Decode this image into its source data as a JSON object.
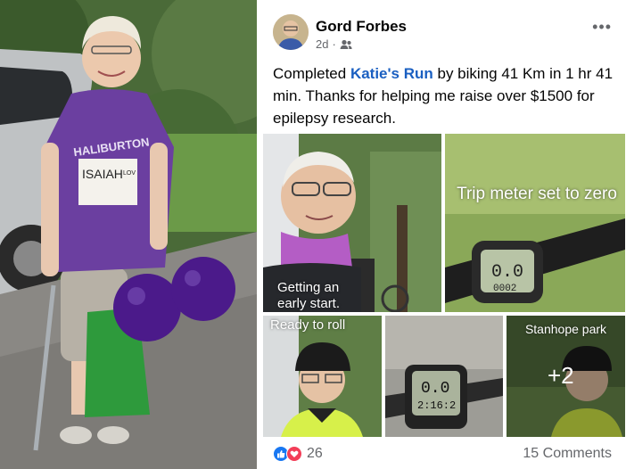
{
  "post": {
    "author": "Gord Forbes",
    "time": "2d",
    "audience_icon": "friends-icon",
    "more_icon": "more-options-icon",
    "text_before": "Completed ",
    "link_text": "Katie's Run",
    "text_after": " by biking 41 Km in 1 hr 41 min. Thanks for helping me raise over $1500 for epilepsy research."
  },
  "photos": {
    "tile1_caption": "Getting an early start.",
    "tile2_caption": "Trip meter set to zero",
    "tile3_caption": "Ready to roll",
    "tile5_caption": "Stanhope park",
    "more_count": "+2"
  },
  "left_photo": {
    "shirt_text": "HALIBURTON",
    "bib_text": "ISAIAH",
    "bib_small": "LOV"
  },
  "footer": {
    "reaction_count": "26",
    "comments": "15 Comments"
  },
  "colors": {
    "link": "#1a5fc1",
    "like": "#1877f2",
    "love": "#f33e58",
    "shirt": "#6b3fa0",
    "balloon": "#4b1a8a"
  }
}
